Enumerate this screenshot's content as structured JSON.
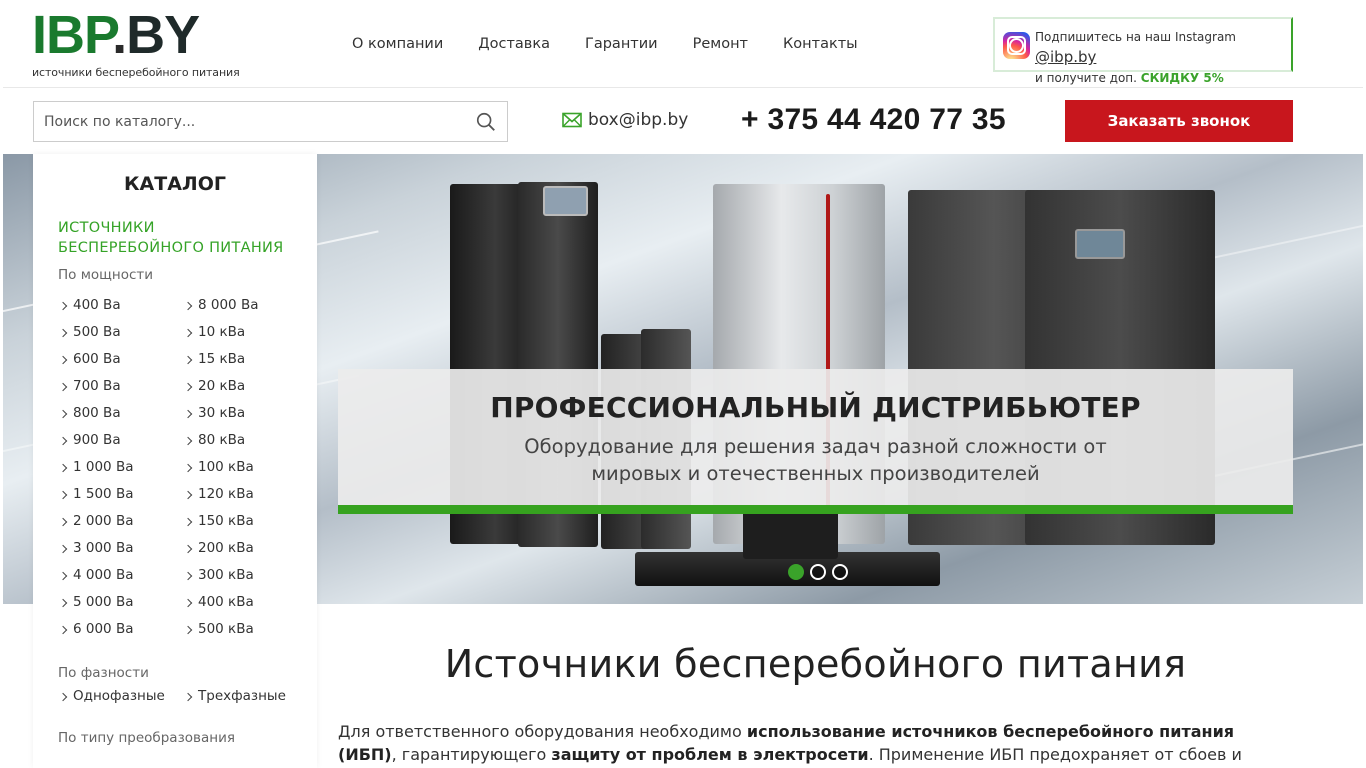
{
  "header": {
    "logo": {
      "main": "IBP",
      "dot": ".",
      "suffix": "BY",
      "tagline": "источники бесперебойного питания"
    },
    "nav": [
      "О компании",
      "Доставка",
      "Гарантии",
      "Ремонт",
      "Контакты"
    ],
    "instagram": {
      "line1_prefix": "Подпишитесь на наш Instagram ",
      "handle": "@ibp.by",
      "line2_prefix": "и получите доп. ",
      "promo": "СКИДКУ 5%"
    }
  },
  "search": {
    "placeholder": "Поиск по каталогу..."
  },
  "contacts": {
    "email": "box@ibp.by",
    "phone": "+ 375 44 420 77 35"
  },
  "callback_button": "Заказать звонок",
  "sidebar": {
    "title": "КАТАЛОГ",
    "section": "ИСТОЧНИКИ БЕСПЕРЕБОЙНОГО ПИТАНИЯ",
    "power_label": "По мощности",
    "power_col1": [
      "400 Ва",
      "500 Ва",
      "600 Ва",
      "700 Ва",
      "800 Ва",
      "900 Ва",
      "1 000 Ва",
      "1 500 Ва",
      "2 000 Ва",
      "3 000 Ва",
      "4 000 Ва",
      "5 000 Ва",
      "6 000 Ва"
    ],
    "power_col2": [
      "8 000 Ва",
      "10 кВа",
      "15 кВа",
      "20 кВа",
      "30 кВа",
      "80 кВа",
      "100 кВа",
      "120 кВа",
      "150 кВа",
      "200 кВа",
      "300 кВа",
      "400 кВа",
      "500 кВа"
    ],
    "phase_label": "По фазности",
    "phases": [
      "Однофазные",
      "Трехфазные"
    ],
    "conversion_label": "По типу преобразования"
  },
  "banner": {
    "title": "ПРОФЕССИОНАЛЬНЫЙ ДИСТРИБЬЮТЕР",
    "subtitle_line1": "Оборудование для решения задач разной сложности от",
    "subtitle_line2": "мировых и отечественных производителей",
    "slides_total": 3,
    "active_slide": 1
  },
  "content": {
    "title": "Источники бесперебойного питания",
    "intro": {
      "p1": "Для ответственного оборудования необходимо ",
      "b1": "использование источников бесперебойного питания (ИБП)",
      "p2": ", гарантирующего ",
      "b2": "защиту от проблем в электросети",
      "p3": ". Применение ИБП предохраняет от сбоев и нестабильностей в"
    }
  },
  "colors": {
    "brand_green": "#1a7a2e",
    "accent_green": "#36a21f",
    "cta_red": "#c8161d"
  }
}
